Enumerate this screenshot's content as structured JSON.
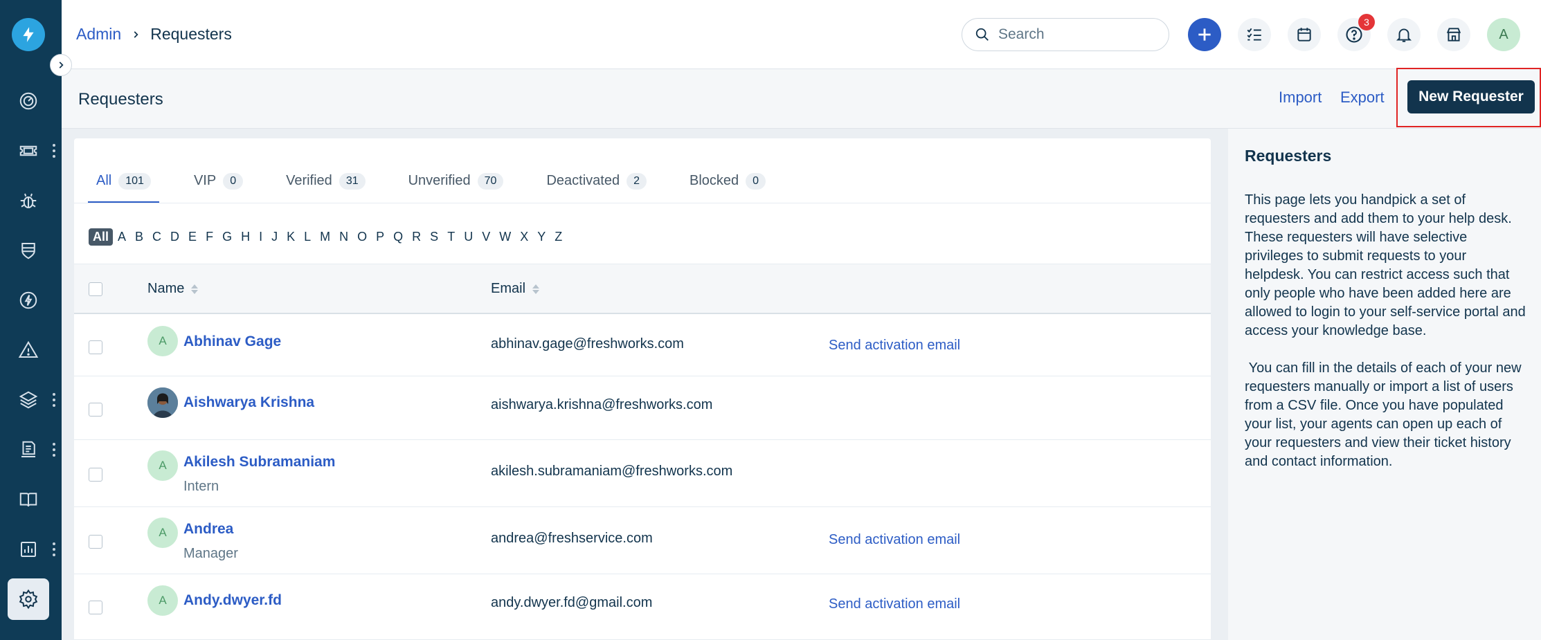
{
  "breadcrumb": {
    "parent": "Admin",
    "current": "Requesters"
  },
  "search": {
    "placeholder": "Search"
  },
  "header": {
    "help_badge": "3",
    "avatar_initial": "A"
  },
  "page": {
    "title": "Requesters",
    "import_label": "Import",
    "export_label": "Export",
    "new_requester_label": "New Requester"
  },
  "tabs": [
    {
      "label": "All",
      "count": "101"
    },
    {
      "label": "VIP",
      "count": "0"
    },
    {
      "label": "Verified",
      "count": "31"
    },
    {
      "label": "Unverified",
      "count": "70"
    },
    {
      "label": "Deactivated",
      "count": "2"
    },
    {
      "label": "Blocked",
      "count": "0"
    }
  ],
  "alphabet": [
    "All",
    "A",
    "B",
    "C",
    "D",
    "E",
    "F",
    "G",
    "H",
    "I",
    "J",
    "K",
    "L",
    "M",
    "N",
    "O",
    "P",
    "Q",
    "R",
    "S",
    "T",
    "U",
    "V",
    "W",
    "X",
    "Y",
    "Z"
  ],
  "table": {
    "col_name": "Name",
    "col_email": "Email",
    "rows": [
      {
        "initial": "A",
        "name": "Abhinav Gage",
        "subtitle": "",
        "email": "abhinav.gage@freshworks.com",
        "action": "Send activation email"
      },
      {
        "initial": "",
        "name": "Aishwarya Krishna",
        "subtitle": "",
        "email": "aishwarya.krishna@freshworks.com",
        "action": ""
      },
      {
        "initial": "A",
        "name": "Akilesh Subramaniam",
        "subtitle": "Intern",
        "email": "akilesh.subramaniam@freshworks.com",
        "action": ""
      },
      {
        "initial": "A",
        "name": "Andrea",
        "subtitle": "Manager",
        "email": "andrea@freshservice.com",
        "action": "Send activation email"
      },
      {
        "initial": "A",
        "name": "Andy.dwyer.fd",
        "subtitle": "",
        "email": "andy.dwyer.fd@gmail.com",
        "action": "Send activation email"
      }
    ]
  },
  "side_panel": {
    "title": "Requesters",
    "para1": "This page lets you handpick a set of requesters and add them to your help desk. These requesters will have selective privileges to submit requests to your helpdesk. You can restrict access such that only people who have been added here are allowed to login to your self-service portal and access your knowledge base.",
    "para2": " You can fill in the details of each of your new requesters manually or import a list of users from a CSV file. Once you have populated your list, your agents can open up each of your requesters and view their ticket history and contact information."
  },
  "colors": {
    "sidebar": "#0f3b56",
    "accent": "#2c5cc5",
    "primary_button": "#12344d",
    "highlight": "#e02424"
  }
}
